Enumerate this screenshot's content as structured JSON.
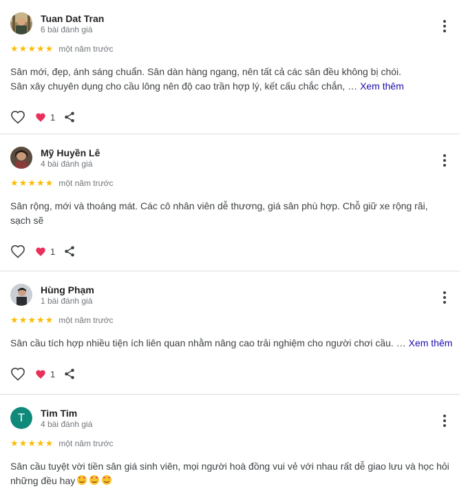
{
  "reviews": [
    {
      "name": "Tuan Dat Tran",
      "count": "6 bài đánh giá",
      "stars": 5,
      "time": "một năm trước",
      "text_line1": "Sân mới, đẹp, ánh sáng chuẩn. Sân dàn hàng ngang, nên tất cả các sân đều không bị chói.",
      "text_line2": "Sân xây chuyên dụng cho cầu lông nên độ cao trần hợp lý, kết cấu chắc chắn, …",
      "more_label": "Xem thêm",
      "reaction_count": "1"
    },
    {
      "name": "Mỹ Huyền Lê",
      "count": "4 bài đánh giá",
      "stars": 5,
      "time": "một năm trước",
      "text": "Sân rộng, mới và thoáng mát. Các cô nhân viên dễ thương, giá sân phù hợp. Chỗ giữ xe rộng rãi, sạch sẽ",
      "reaction_count": "1"
    },
    {
      "name": "Hùng Phạm",
      "count": "1 bài đánh giá",
      "stars": 5,
      "time": "một năm trước",
      "text": "Sân cầu tích hợp nhiều tiện ích liên quan nhằm nâng cao trải nghiệm cho người chơi cầu. …",
      "more_label": "Xem thêm",
      "reaction_count": "1"
    },
    {
      "name": "Tim Tim",
      "avatar_letter": "T",
      "count": "4 bài đánh giá",
      "stars": 5,
      "time": "một năm trước",
      "text": "Sân cầu tuyệt vời tiền sân giá sinh viên, mọi người hoà đồng vui vẻ với nhau rất dễ giao lưu và học hỏi những đều hay"
    }
  ],
  "icons": {
    "star": "star-icon",
    "more": "more-vert-icon",
    "like": "heart-outline-icon",
    "reaction": "heart-filled-icon",
    "share": "share-icon",
    "emoji": "smiling-face-with-hearts-emoji"
  },
  "colors": {
    "star": "#fbbc04",
    "reaction_heart": "#e8305a",
    "link": "#1a0dab",
    "avatar_letter_bg": "#0f8a7a"
  }
}
